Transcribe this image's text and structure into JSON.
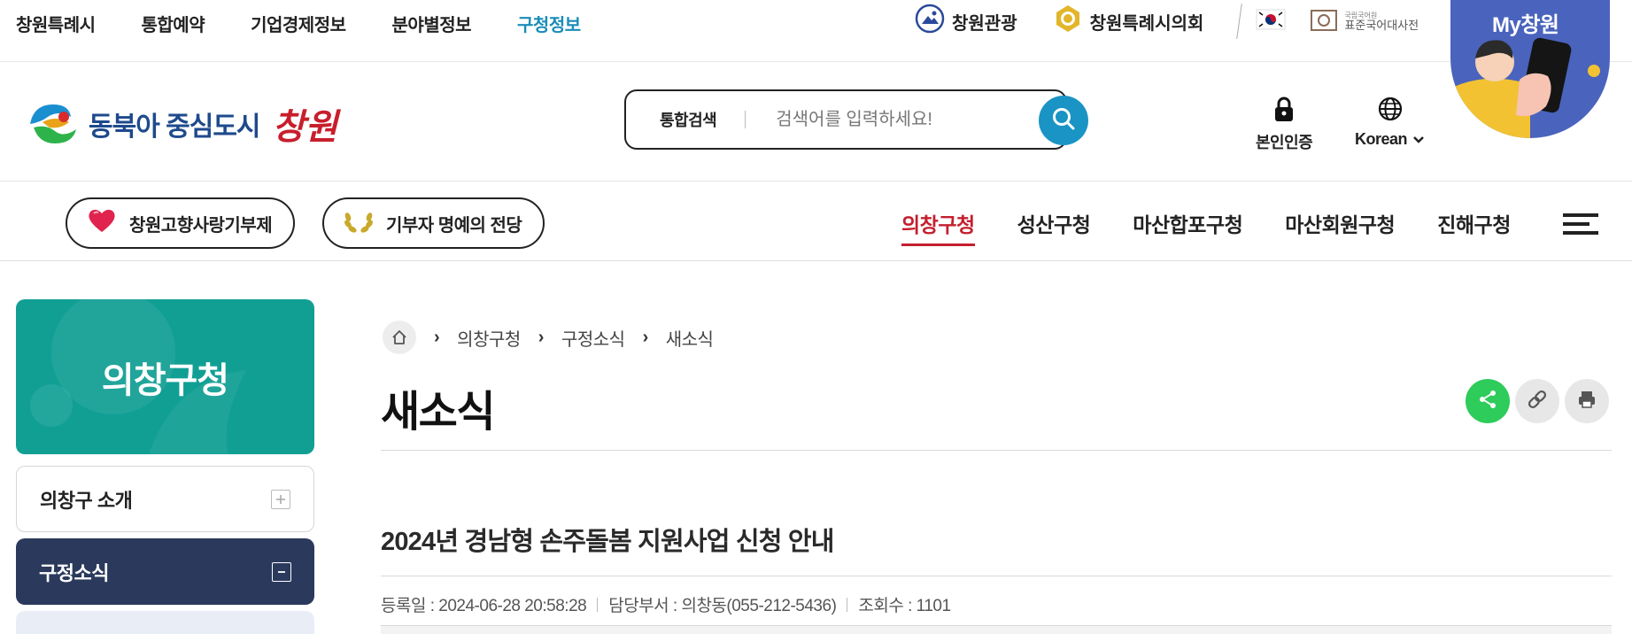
{
  "top_nav": {
    "items": [
      "창원특례시",
      "통합예약",
      "기업경제정보",
      "분야별정보",
      "구청정보"
    ],
    "active_index": 4
  },
  "top_links": {
    "tourism": "창원관광",
    "council": "창원특례시의회",
    "dictionary_small": "국립국어원",
    "dictionary": "표준국어대사전"
  },
  "my_badge": {
    "title": "My창원"
  },
  "header": {
    "logo_text": "동북아 중심도시",
    "logo_cursive": "창원",
    "search_label": "통합검색",
    "search_placeholder": "검색어를 입력하세요!",
    "auth_label": "본인인증",
    "language_label": "Korean"
  },
  "main_nav": {
    "pill_donation": "창원고향사랑기부제",
    "pill_hall": "기부자 명예의 전당",
    "districts": [
      "의창구청",
      "성산구청",
      "마산합포구청",
      "마산회원구청",
      "진해구청"
    ],
    "active_index": 0
  },
  "sidebar": {
    "hero_title": "의창구청",
    "items": [
      {
        "label": "의창구 소개",
        "state": "collapsed"
      },
      {
        "label": "구정소식",
        "state": "expanded"
      }
    ]
  },
  "breadcrumb": [
    "의창구청",
    "구정소식",
    "새소식"
  ],
  "page": {
    "title": "새소식",
    "post_title": "2024년 경남형 손주돌봄 지원사업 신청 안내",
    "meta": {
      "date_label": "등록일 : 2024-06-28 20:58:28",
      "dept_label": "담당부서 : 의창동(055-212-5436)",
      "views_label": "조회수 : 1101"
    }
  },
  "colors": {
    "accent_blue": "#1a94c4",
    "active_red": "#c41f2e",
    "sidebar_teal": "#119f94",
    "sidebar_navy": "#2b3a5c",
    "share_green": "#2ecc5a",
    "badge_blue": "#4a63bd"
  }
}
